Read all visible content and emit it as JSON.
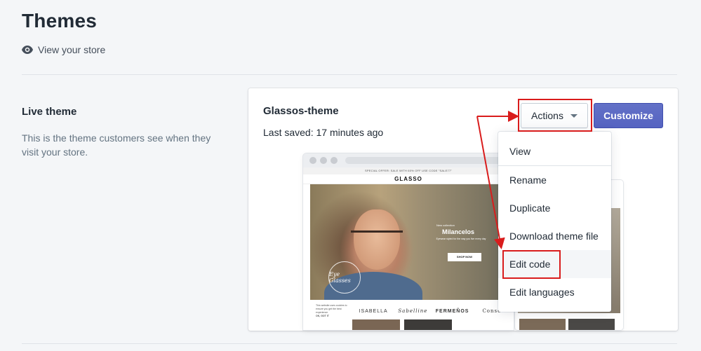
{
  "header": {
    "title": "Themes",
    "view_store_label": "View your store"
  },
  "live_theme_section": {
    "title": "Live theme",
    "description": "This is the theme customers see when they visit your store."
  },
  "theme_card": {
    "name": "Glassos-theme",
    "last_saved": "Last saved: 17 minutes ago",
    "actions_label": "Actions",
    "customize_label": "Customize"
  },
  "actions_menu": {
    "items": [
      {
        "label": "View"
      },
      {
        "label": "Rename"
      },
      {
        "label": "Duplicate"
      },
      {
        "label": "Download theme file"
      },
      {
        "label": "Edit code"
      },
      {
        "label": "Edit languages"
      }
    ]
  },
  "preview": {
    "announcement": "SPECIAL OFFER: SALE WITH 60% OFF USE CODE \"SALE77\"",
    "logo": "GLASSO",
    "hero_kicker": "New collection",
    "hero_heading": "Milancelos",
    "hero_body": "Eyewear styled for the way you live every day",
    "hero_button": "SHOP NOW",
    "seal_text": "Eye Glasses",
    "cookie_note": "This website uses cookies to ensure you get the best experience.",
    "cookie_button": "OK, GOT IT",
    "brands": [
      "ISABELLA",
      "Sabelline",
      "FERMEÑOS",
      "Conse"
    ]
  },
  "colors": {
    "primary_button": "#5c6ac4",
    "annotation_red": "#d91c1c",
    "text_primary": "#212b36",
    "text_subdued": "#637381"
  },
  "icons": {
    "view_store": "eye-icon",
    "actions_caret": "caret-down-icon"
  }
}
